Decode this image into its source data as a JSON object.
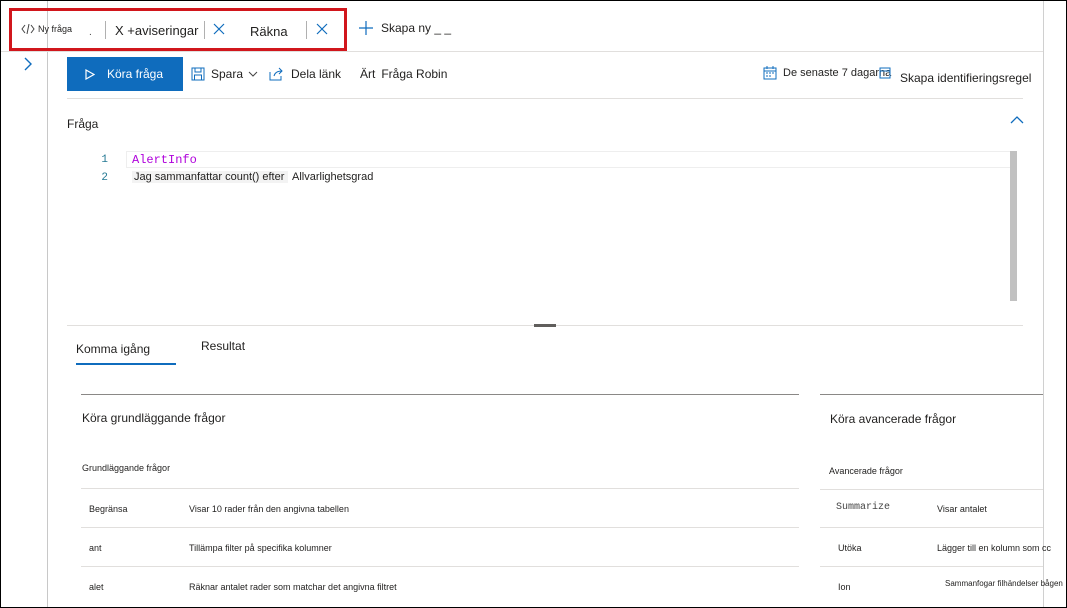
{
  "tabs": {
    "tab1_label": "Ny fråga",
    "tab1_dots": ".",
    "tab2_label": "X +aviseringar",
    "tab3_label": "Räkna",
    "new_query": "Skapa ny _ _"
  },
  "toolbar": {
    "run": "Köra fråga",
    "save": "Spara",
    "share": "Dela länk",
    "query_prefix": "Ärt",
    "query_name": "Fråga Robin",
    "time_range": "De senaste 7 dagarna",
    "create_rule": "Skapa identifieringsregel"
  },
  "query_section": {
    "title": "Fråga"
  },
  "editor": {
    "line1_no": "1",
    "line1": "AlertInfo",
    "line2_no": "2",
    "line2_a": "Jag sammanfattar count() efter",
    "line2_b": "Allvarlighetsgrad"
  },
  "bottom_tabs": {
    "get_started": "Komma igång",
    "results": "Resultat"
  },
  "basic_card": {
    "title": "Köra grundläggande frågor",
    "subtitle": "Grundläggande frågor",
    "rows": [
      {
        "op": "Begränsa",
        "desc": "Visar 10 rader från den angivna tabellen"
      },
      {
        "op": "ant",
        "desc": "Tillämpa filter på specifika kolumner"
      },
      {
        "op": "alet",
        "desc": "Räknar antalet rader som matchar det angivna filtret"
      }
    ]
  },
  "advanced_card": {
    "title": "Köra avancerade frågor",
    "subtitle": "Avancerade frågor",
    "rows": [
      {
        "op": "Summarize",
        "desc": "Visar antalet"
      },
      {
        "op": "Utöka",
        "desc": "Lägger till en kolumn som cc"
      },
      {
        "op": "Ion",
        "desc": "Sammanfogar filhändelser bågen"
      }
    ]
  },
  "colors": {
    "accent": "#0f6cbd",
    "highlight_box": "#d1161c",
    "keyword": "#af00db"
  }
}
